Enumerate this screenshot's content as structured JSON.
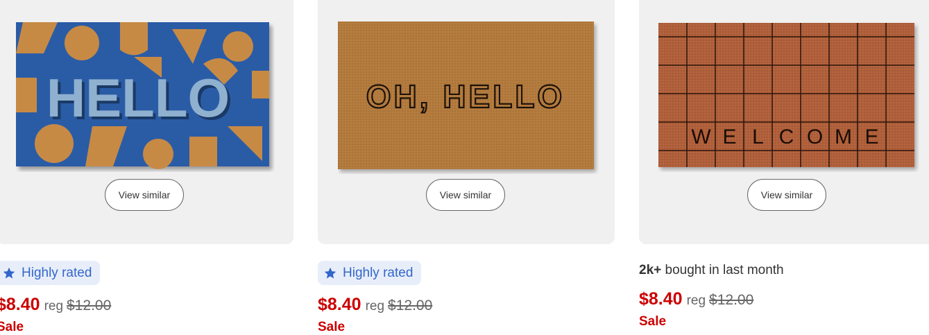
{
  "products": [
    {
      "mat_text": "HELLO",
      "view_similar": "View similar",
      "badge": "Highly rated",
      "price": "$8.40",
      "reg_label": "reg",
      "reg_price": "$12.00",
      "sale": "Sale"
    },
    {
      "mat_text": "OH, HELLO",
      "view_similar": "View similar",
      "badge": "Highly rated",
      "price": "$8.40",
      "reg_label": "reg",
      "reg_price": "$12.00",
      "sale": "Sale"
    },
    {
      "mat_letters": [
        "W",
        "E",
        "L",
        "C",
        "O",
        "M",
        "E"
      ],
      "view_similar": "View similar",
      "bought_count": "2k+",
      "bought_text": " bought in last month",
      "price": "$8.40",
      "reg_label": "reg",
      "reg_price": "$12.00",
      "sale": "Sale"
    }
  ],
  "colors": {
    "sale_red": "#cc0000",
    "badge_bg": "#e8eef9",
    "badge_blue": "#3366cc",
    "card_bg": "#f0f0f0"
  },
  "icons": {
    "badge": "star-icon"
  }
}
